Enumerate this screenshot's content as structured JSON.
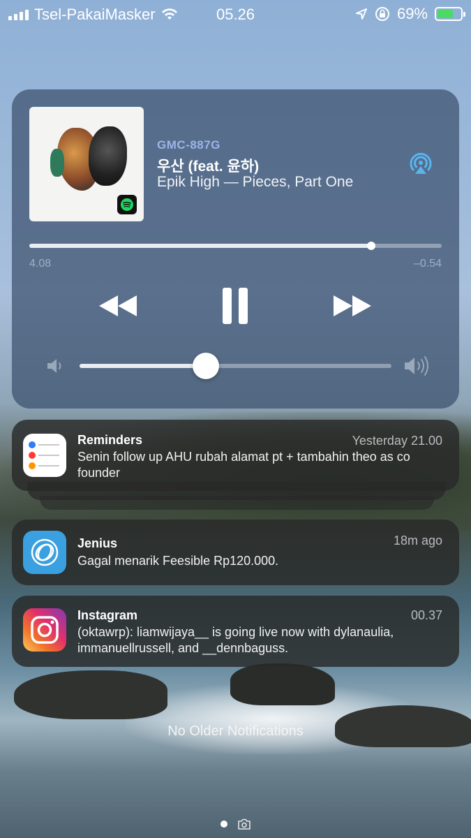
{
  "status_bar": {
    "carrier": "Tsel-PakaiMasker",
    "time": "05.26",
    "battery": "69%",
    "battery_level": 0.69
  },
  "now_playing": {
    "device": "GMC-887G",
    "title": "우산 (feat. 윤하)",
    "artist_album": "Epik High — Pieces, Part One",
    "elapsed": "4.08",
    "remaining": "–0.54",
    "progress": 0.829,
    "volume": 0.405,
    "icons": {
      "airplay": "airplay-icon",
      "rewind": "rewind-icon",
      "pause": "pause-icon",
      "forward": "fast-forward-icon",
      "spotify": "spotify-icon"
    }
  },
  "notifications": [
    {
      "app": "Reminders",
      "time": "Yesterday 21.00",
      "body": "Senin follow up AHU rubah alamat pt + tambahin theo as co founder",
      "icon": "reminders-icon"
    },
    {
      "app": "Jenius",
      "time": "18m ago",
      "body": "Gagal menarik Feesible Rp120.000.",
      "icon": "jenius-icon"
    },
    {
      "app": "Instagram",
      "time": "00.37",
      "body": "(oktawrp): liamwijaya__ is going live now with dylanaulia, immanuellrussell, and __dennbaguss.",
      "icon": "instagram-icon"
    }
  ],
  "footer": {
    "no_older": "No Older Notifications"
  },
  "colors": {
    "accent_blue": "#5ab4f0",
    "battery_green": "#4cd964"
  }
}
